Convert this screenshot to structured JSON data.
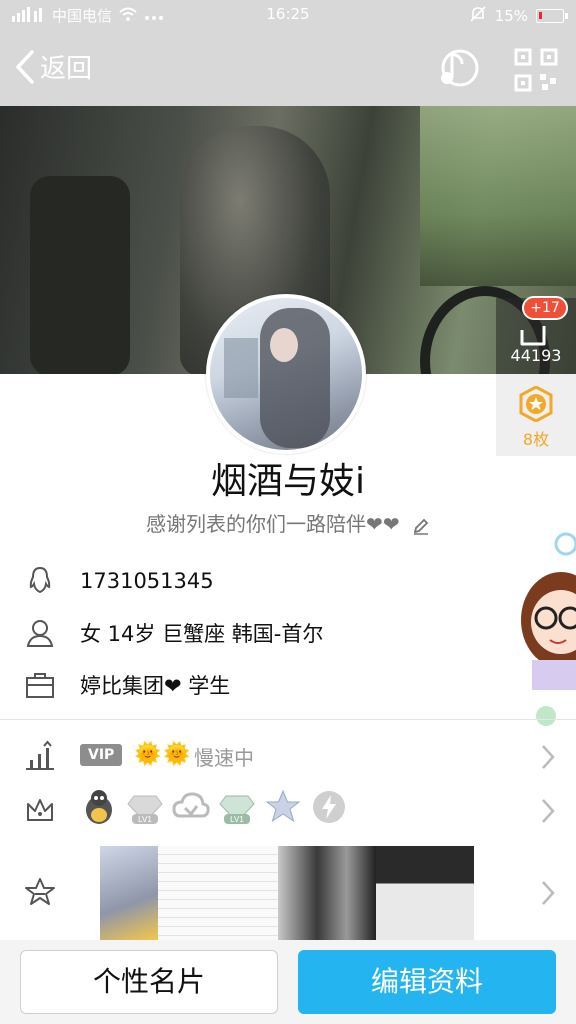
{
  "status_bar": {
    "carrier": "中国电信",
    "time": "16:25",
    "battery_percent": "15%",
    "battery_level": 0.15,
    "icons": [
      "signal-icon",
      "wifi-icon",
      "more-dots-icon",
      "alarm-off-icon",
      "battery-icon"
    ]
  },
  "nav": {
    "back_label": "返回",
    "music_icon": "music-icon",
    "qr_icon": "qrcode-icon"
  },
  "cover": {
    "likes_badge": "+17",
    "likes_count": "44193",
    "medal_label": "8枚"
  },
  "profile": {
    "nickname": "烟酒与妓i",
    "signature": "感谢列表的你们一路陪伴❤❤"
  },
  "info": {
    "qq_number": "1731051345",
    "personal": "女  14岁  巨蟹座  韩国-首尔",
    "work": "婷比集团❤  学生"
  },
  "services": {
    "vip_label": "VIP",
    "suns": "🌞🌞",
    "speed_status": "慢速中"
  },
  "medals": [
    "qq-penguin-icon",
    "diamond-lv1-icon",
    "cloud-sync-icon",
    "diamond-green-lv1-icon",
    "star-icon",
    "lightning-icon"
  ],
  "buttons": {
    "card_label": "个性名片",
    "edit_label": "编辑资料"
  },
  "colors": {
    "accent": "#24b4ef",
    "badge_red": "#f04e37",
    "medal_gold": "#f0a92a"
  }
}
